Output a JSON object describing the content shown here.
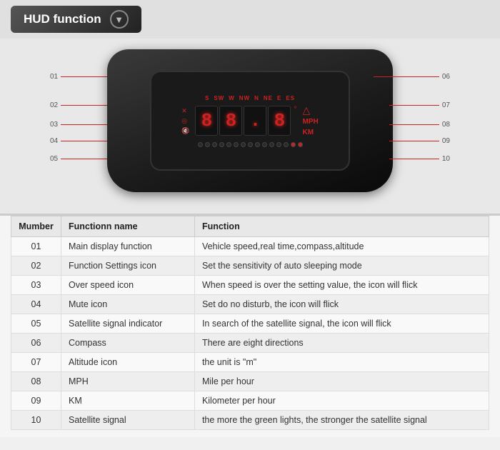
{
  "header": {
    "title": "HUD function",
    "dropdown_icon": "▼"
  },
  "device": {
    "compass_labels": [
      "S",
      "SW",
      "W",
      "NW",
      "N",
      "NE",
      "E",
      "ES"
    ],
    "digits": [
      "8",
      "8",
      ".",
      "8"
    ],
    "units": [
      "MPH",
      "KM"
    ],
    "left_labels": [
      {
        "num": "01",
        "line_width": 90
      },
      {
        "num": "02",
        "line_width": 65
      },
      {
        "num": "03",
        "line_width": 65
      },
      {
        "num": "04",
        "line_width": 65
      },
      {
        "num": "05",
        "line_width": 65
      }
    ],
    "right_labels": [
      {
        "num": "06",
        "line_width": 90
      },
      {
        "num": "07",
        "line_width": 65
      },
      {
        "num": "08",
        "line_width": 65
      },
      {
        "num": "09",
        "line_width": 65
      },
      {
        "num": "10",
        "line_width": 65
      }
    ]
  },
  "table": {
    "headers": [
      "Mumber",
      "Functionn name",
      "Function"
    ],
    "rows": [
      {
        "num": "01",
        "name": "Main display function",
        "desc": "Vehicle speed,real time,compass,altitude"
      },
      {
        "num": "02",
        "name": "Function Settings icon",
        "desc": "Set the sensitivity of auto sleeping mode"
      },
      {
        "num": "03",
        "name": "Over speed icon",
        "desc": " When speed is over the setting value, the icon will flick"
      },
      {
        "num": "04",
        "name": "Mute icon",
        "desc": "Set do no disturb, the icon will flick"
      },
      {
        "num": "05",
        "name": "Satellite signal indicator",
        "desc": "In search of the satellite signal, the icon will flick"
      },
      {
        "num": "06",
        "name": "Compass",
        "desc": "There are eight directions"
      },
      {
        "num": "07",
        "name": "Altitude icon",
        "desc": "the unit is  \"m\""
      },
      {
        "num": "08",
        "name": "MPH",
        "desc": "Mile per hour"
      },
      {
        "num": "09",
        "name": "KM",
        "desc": "Kilometer per hour"
      },
      {
        "num": "10",
        "name": "Satellite signal",
        "desc": "the more the green lights, the stronger the satellite signal"
      }
    ]
  }
}
